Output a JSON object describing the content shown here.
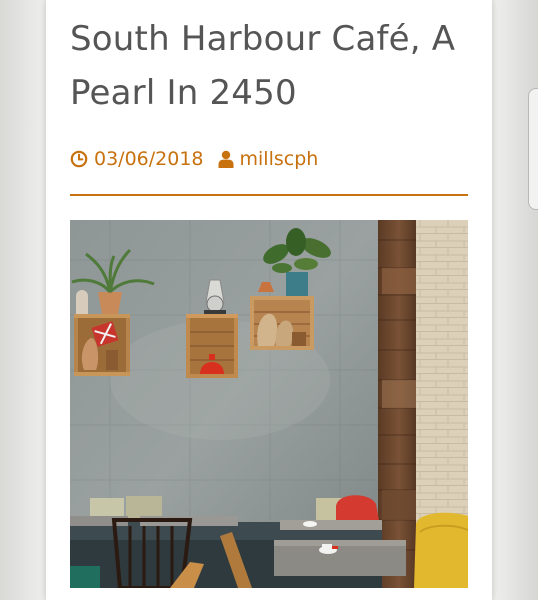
{
  "post": {
    "title": "South Harbour Café, A Pearl In 2450",
    "date": "03/06/2018",
    "author": "millscph"
  },
  "icons": {
    "date": "clock-icon",
    "author": "user-icon"
  },
  "colors": {
    "accent": "#c8710f",
    "title": "#555555",
    "background": "#ffffff"
  }
}
